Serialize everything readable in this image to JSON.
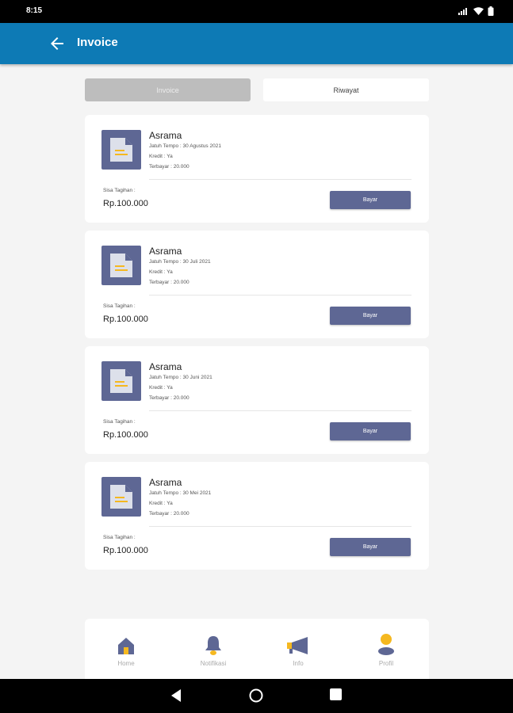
{
  "status": {
    "time": "8:15"
  },
  "appbar": {
    "title": "Invoice"
  },
  "tabs": [
    {
      "label": "Invoice",
      "active": true
    },
    {
      "label": "Riwayat",
      "active": false
    }
  ],
  "invoices": [
    {
      "name": "Asrama",
      "due": "Jatuh Tempo : 30 Agustus 2021",
      "credit": "Kredit : Ya",
      "paid": "Terbayar : 20.000",
      "remaining_label": "Sisa Tagihan :",
      "amount": "Rp.100.000",
      "pay_label": "Bayar"
    },
    {
      "name": "Asrama",
      "due": "Jatuh Tempo : 30 Juli 2021",
      "credit": "Kredit : Ya",
      "paid": "Terbayar : 20.000",
      "remaining_label": "Sisa Tagihan :",
      "amount": "Rp.100.000",
      "pay_label": "Bayar"
    },
    {
      "name": "Asrama",
      "due": "Jatuh Tempo : 30 Juni 2021",
      "credit": "Kredit : Ya",
      "paid": "Terbayar : 20.000",
      "remaining_label": "Sisa Tagihan :",
      "amount": "Rp.100.000",
      "pay_label": "Bayar"
    },
    {
      "name": "Asrama",
      "due": "Jatuh Tempo : 30 Mei 2021",
      "credit": "Kredit : Ya",
      "paid": "Terbayar : 20.000",
      "remaining_label": "Sisa Tagihan :",
      "amount": "Rp.100.000",
      "pay_label": "Bayar"
    }
  ],
  "bottom_nav": [
    {
      "label": "Home",
      "icon": "home-icon"
    },
    {
      "label": "Notifikasi",
      "icon": "bell-icon"
    },
    {
      "label": "Info",
      "icon": "megaphone-icon"
    },
    {
      "label": "Profil",
      "icon": "user-icon"
    }
  ],
  "colors": {
    "appbar": "#0d7ab5",
    "accent": "#5e6794",
    "highlight": "#f5b820",
    "background": "#f4f4f4"
  }
}
